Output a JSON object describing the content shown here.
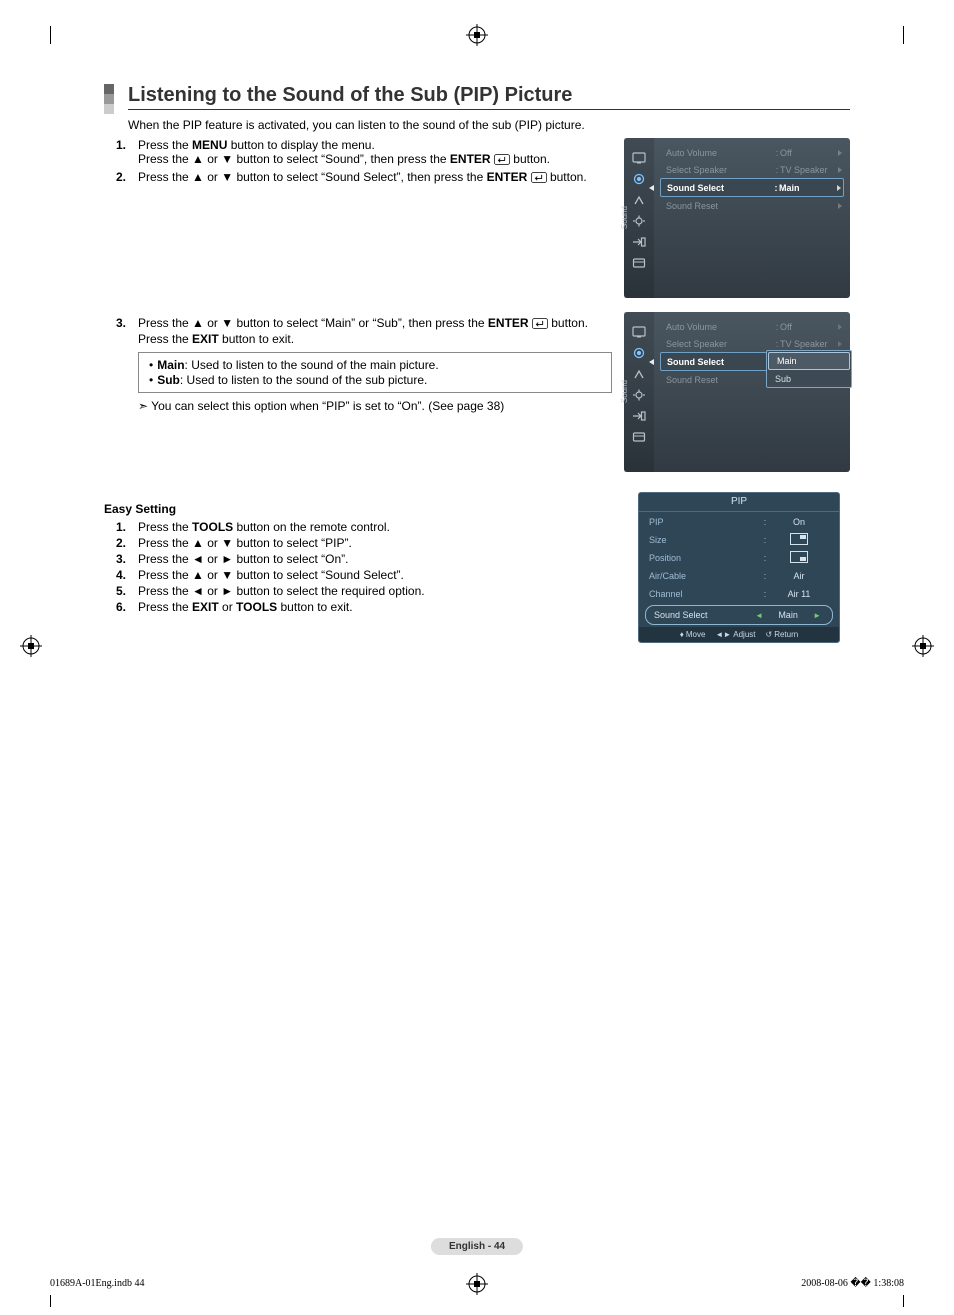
{
  "title": "Listening to the Sound of the Sub (PIP) Picture",
  "intro": "When the PIP feature is activated, you can listen to the sound of the sub (PIP) picture.",
  "steps_main": [
    {
      "n": "1.",
      "html": "Press the <b>MENU</b> button to display the menu.<br>Press the ▲ or ▼ button to select “Sound”, then press the <b>ENTER</b> {ENTER} button."
    },
    {
      "n": "2.",
      "html": "Press the ▲ or ▼ button to select “Sound Select”, then press the <b>ENTER</b> {ENTER} button."
    },
    {
      "n": "3.",
      "html": "Press the ▲ or ▼ button to select “Main” or “Sub”, then press the <b>ENTER</b> {ENTER} button.<br>Press the <b>EXIT</b> button to exit."
    }
  ],
  "notes": {
    "main": "Main",
    "main_txt": ": Used to listen to the sound of the main picture.",
    "sub": "Sub",
    "sub_txt": ": Used to listen to the sound of the sub picture."
  },
  "tip": "You can select this option when “PIP” is set to “On”. (See page 38)",
  "easy_title": "Easy Setting",
  "steps_easy": [
    {
      "n": "1.",
      "html": "Press the <b>TOOLS</b> button on the remote control."
    },
    {
      "n": "2.",
      "html": "Press the ▲ or ▼ button to select “PIP”."
    },
    {
      "n": "3.",
      "html": "Press the ◄ or ► button to select “On”."
    },
    {
      "n": "4.",
      "html": "Press the ▲ or ▼ button to select “Sound Select”."
    },
    {
      "n": "5.",
      "html": "Press the ◄ or ► button to select the required option."
    },
    {
      "n": "6.",
      "html": "Press the <b>EXIT</b> or <b>TOOLS</b> button to exit."
    }
  ],
  "osd": {
    "side_label": "Sound",
    "items": [
      {
        "label": "Auto Volume",
        "val": "Off",
        "dim": true
      },
      {
        "label": "Select Speaker",
        "val": "TV Speaker",
        "dim": true
      },
      {
        "label": "Sound Select",
        "val": "Main",
        "sel": true
      },
      {
        "label": "Sound Reset",
        "val": "",
        "dim": true
      }
    ],
    "popup": [
      "Main",
      "Sub"
    ]
  },
  "pip": {
    "title": "PIP",
    "rows": [
      {
        "label": "PIP",
        "val": "On"
      },
      {
        "label": "Size",
        "val": "__size__"
      },
      {
        "label": "Position",
        "val": "__pos__"
      },
      {
        "label": "Air/Cable",
        "val": "Air"
      },
      {
        "label": "Channel",
        "val": "Air 11"
      }
    ],
    "sel": {
      "label": "Sound Select",
      "val": "Main"
    },
    "footer": {
      "move": "Move",
      "adjust": "Adjust",
      "ret": "Return"
    }
  },
  "page_num": "English - 44",
  "foot_left": "01689A-01Eng.indb   44",
  "foot_right": "2008-08-06   �� 1:38:08"
}
